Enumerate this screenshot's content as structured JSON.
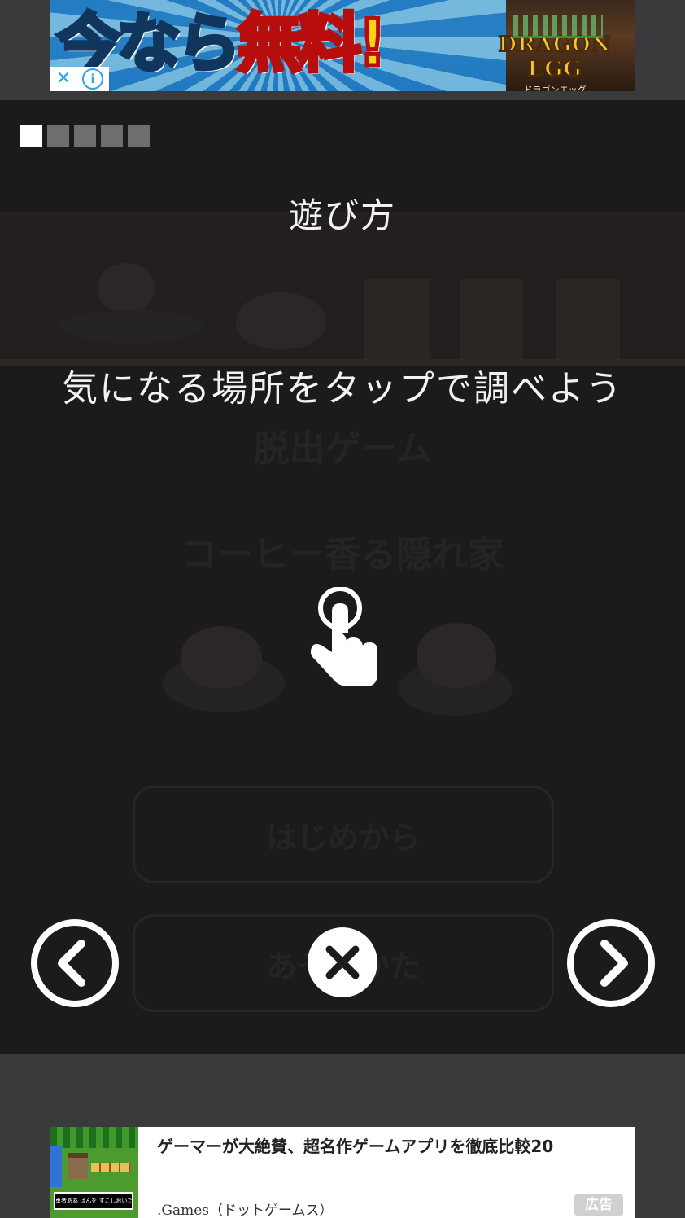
{
  "top_ad": {
    "headline_part1": "今なら",
    "headline_part2": "無料!",
    "brand_logo": "DRAGON EGG",
    "brand_sub": "ドラゴンエッグ",
    "close_glyph": "✕",
    "info_glyph": "i"
  },
  "game": {
    "background_title": "脱出ゲーム",
    "background_subtitle": "コーヒー香る隠れ家",
    "background_button_start": "はじめから",
    "background_button_continue": "あそびかた",
    "progress": {
      "total_pages": 5,
      "current_page": 1
    },
    "howto_title": "遊び方",
    "howto_text": "気になる場所をタップで調べよう",
    "hand_icon": "tap-hand-icon",
    "prev_icon": "chevron-left-icon",
    "next_icon": "chevron-right-icon",
    "close_icon": "close-icon"
  },
  "bottom_ad": {
    "title": "ゲーマーが大絶賛、超名作ゲームアプリを徹底比較20",
    "source": ".Games（ドットゲームス）",
    "label": "広告",
    "thumbnail_dialog": "勇者ああ ぱんを すこしおいた！"
  },
  "colors": {
    "page_bg": "#3a393b",
    "overlay_bg": "#1c1b1c",
    "progress_active": "#ffffff",
    "progress_inactive": "#6e6d6f",
    "text": "#f2f2f2"
  }
}
